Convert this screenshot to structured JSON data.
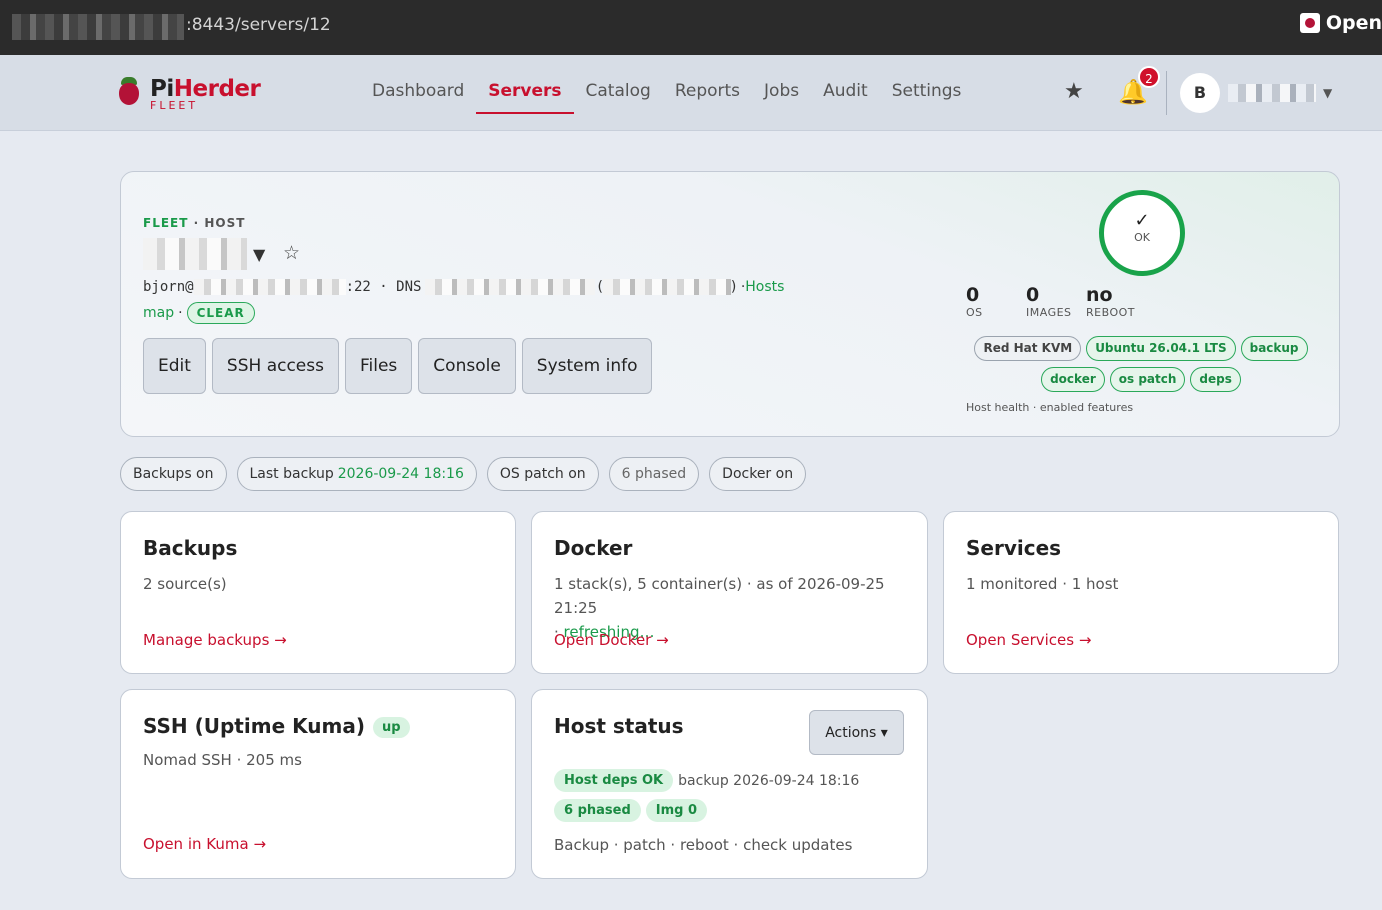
{
  "browser": {
    "url": "​:8443/servers/12",
    "ext_label": "Open"
  },
  "brand": {
    "name_pi": "Pi",
    "name_herder": "Herder",
    "sub": "FLEET"
  },
  "nav": {
    "links": [
      "Dashboard",
      "Servers",
      "Catalog",
      "Reports",
      "Jobs",
      "Audit",
      "Settings"
    ],
    "active": "Servers",
    "notifications": "2",
    "avatar_initial": "B"
  },
  "host": {
    "eyebrow_green": "FLEET",
    "eyebrow_rest": " · HOST",
    "user_prefix": "bjorn@",
    "port_suffix": ":22 · DNS",
    "paren_open": "(",
    "paren_close": ") · ",
    "hosts_link": "Hosts",
    "map_link": "map",
    "dot": " · ",
    "status_pill": "CLEAR",
    "buttons": [
      "Edit",
      "SSH access",
      "Files",
      "Console",
      "System info"
    ],
    "health": {
      "check": "✓",
      "label": "OK"
    },
    "stats": [
      {
        "value": "0",
        "label": "OS"
      },
      {
        "value": "0",
        "label": "IMAGES"
      },
      {
        "value": "no",
        "label": "REBOOT"
      }
    ],
    "tags": [
      {
        "text": "Red Hat KVM",
        "green": false
      },
      {
        "text": "Ubuntu 26.04.1 LTS",
        "green": true
      },
      {
        "text": "backup",
        "green": true
      },
      {
        "text": "docker",
        "green": true
      },
      {
        "text": "os patch",
        "green": true
      },
      {
        "text": "deps",
        "green": true
      }
    ],
    "footnote": "Host health · enabled features"
  },
  "chips": {
    "backups": "Backups on",
    "last_backup_label": "Last backup",
    "last_backup_value": "2026-09-24 18:16",
    "os_patch": "OS patch on",
    "phased": "6 phased",
    "docker": "Docker on"
  },
  "cards": {
    "backups": {
      "title": "Backups",
      "desc": "2 source(s)",
      "link": "Manage backups →"
    },
    "docker": {
      "title": "Docker",
      "desc": "1 stack(s), 5 container(s) · as of 2026-09-25 21:25",
      "desc2_prefix": "· ",
      "desc2_green": "refreshing…",
      "link": "Open Docker →"
    },
    "services": {
      "title": "Services",
      "desc": "1 monitored · 1 host",
      "link": "Open Services →"
    },
    "ssh": {
      "title": "SSH (Uptime Kuma)",
      "badge": "up",
      "desc": "Nomad SSH · 205 ms",
      "link": "Open in Kuma →"
    },
    "host_status": {
      "title": "Host status",
      "actions": "Actions ▾",
      "pill1": "Host deps OK",
      "pill1_after": "backup 2026-09-24 18:16",
      "pill2": "6 phased",
      "pill3": "Img 0",
      "footer": "Backup · patch · reboot · check updates"
    }
  }
}
